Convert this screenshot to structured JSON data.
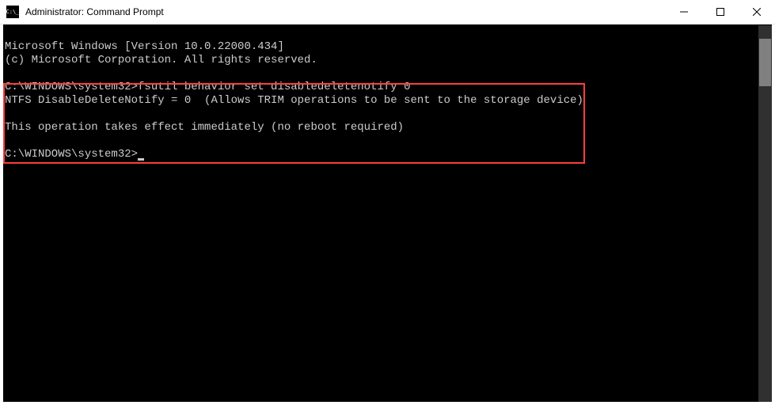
{
  "window": {
    "title": "Administrator: Command Prompt"
  },
  "terminal": {
    "line1": "Microsoft Windows [Version 10.0.22000.434]",
    "line2": "(c) Microsoft Corporation. All rights reserved.",
    "blank1": "",
    "promptLine1Prompt": "C:\\WINDOWS\\system32>",
    "promptLine1Cmd": "fsutil behavior set disabledeletenotify 0",
    "outLine1": "NTFS DisableDeleteNotify = 0  (Allows TRIM operations to be sent to the storage device)",
    "blank2": "",
    "outLine2": "This operation takes effect immediately (no reboot required)",
    "blank3": "",
    "prompt2": "C:\\WINDOWS\\system32>"
  },
  "colors": {
    "highlight": "#ff3d3d"
  }
}
